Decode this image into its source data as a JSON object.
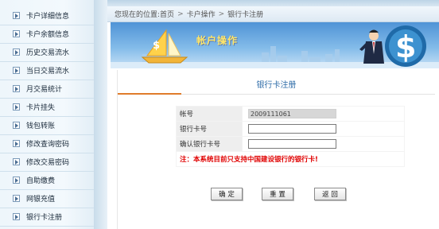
{
  "sidebar": {
    "items": [
      {
        "label": "卡户详细信息"
      },
      {
        "label": "卡户余额信息"
      },
      {
        "label": "历史交易流水"
      },
      {
        "label": "当日交易流水"
      },
      {
        "label": "月交易统计"
      },
      {
        "label": "卡片挂失"
      },
      {
        "label": "钱包转账"
      },
      {
        "label": "修改查询密码"
      },
      {
        "label": "修改交易密码"
      },
      {
        "label": "自助缴费"
      },
      {
        "label": "网银充值"
      },
      {
        "label": "银行卡注册"
      }
    ]
  },
  "breadcrumb": {
    "prefix": "您现在的位置:",
    "home": "首页",
    "section": "卡户操作",
    "current": "银行卡注册"
  },
  "banner": {
    "title": "帐户操作"
  },
  "form": {
    "title": "银行卡注册",
    "account_label": "帐号",
    "account_value": "2009111061",
    "card_label": "银行卡号",
    "card_value": "",
    "confirm_label": "确认银行卡号",
    "confirm_value": "",
    "note": "注：本系统目前只支持中国建设银行的银行卡!"
  },
  "buttons": {
    "confirm": "确 定",
    "reset": "重 置",
    "back": "返 回"
  }
}
